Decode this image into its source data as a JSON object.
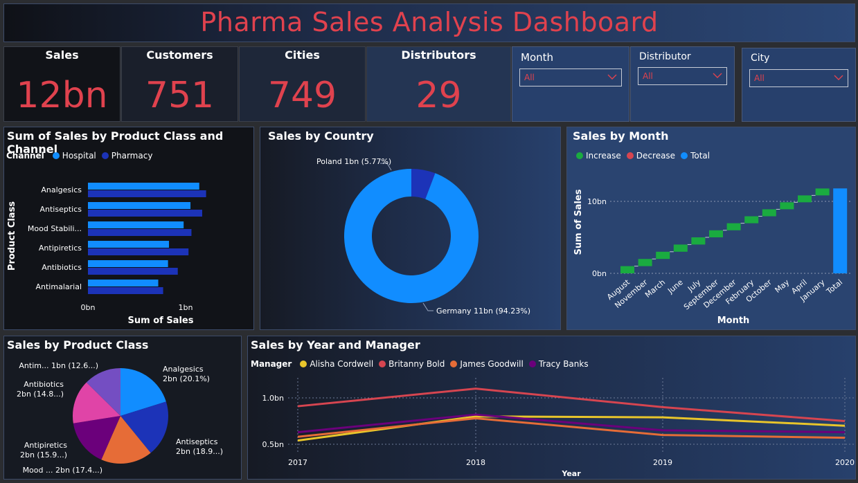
{
  "header": {
    "title": "Pharma Sales Analysis Dashboard"
  },
  "kpis": [
    {
      "label": "Sales",
      "value": "12bn"
    },
    {
      "label": "Customers",
      "value": "751"
    },
    {
      "label": "Cities",
      "value": "749"
    },
    {
      "label": "Distributors",
      "value": "29"
    }
  ],
  "slicers": {
    "month": {
      "label": "Month",
      "value": "All"
    },
    "distributor": {
      "label": "Distributor",
      "value": "All"
    },
    "city": {
      "label": "City",
      "value": "All"
    }
  },
  "colors": {
    "accent_red": "#e0424e",
    "hospital": "#118dff",
    "pharmacy": "#1c33b8",
    "increase": "#1aab40",
    "decrease": "#d64550",
    "total": "#118dff"
  },
  "chart_data": [
    {
      "type": "bar",
      "title": "Sum of Sales by Product Class and Channel",
      "legend_title": "Channel",
      "xlabel": "Sum of Sales",
      "ylabel": "Product Class",
      "categories": [
        "Analgesics",
        "Antiseptics",
        "Mood Stabili...",
        "Antipiretics",
        "Antibiotics",
        "Antimalarial"
      ],
      "series": [
        {
          "name": "Hospital",
          "values": [
            1.14,
            1.05,
            0.98,
            0.83,
            0.82,
            0.72
          ]
        },
        {
          "name": "Pharmacy",
          "values": [
            1.21,
            1.17,
            1.06,
            1.03,
            0.92,
            0.77
          ]
        }
      ],
      "xticks": [
        "0bn",
        "1bn"
      ],
      "xlim": [
        0,
        1.5
      ]
    },
    {
      "type": "pie",
      "title": "Sales by Country",
      "labels": [
        "Poland",
        "Germany"
      ],
      "values": [
        5.77,
        94.23
      ],
      "data_labels": [
        "Poland 1bn (5.77%)",
        "Germany 11bn (94.23%)"
      ]
    },
    {
      "type": "bar",
      "title": "Sales by Month",
      "legend": [
        "Increase",
        "Decrease",
        "Total"
      ],
      "xlabel": "Month",
      "ylabel": "Sum of Sales",
      "categories": [
        "August",
        "November",
        "March",
        "June",
        "July",
        "September",
        "December",
        "February",
        "October",
        "May",
        "April",
        "January",
        "Total"
      ],
      "values": [
        1.0,
        1.0,
        1.0,
        1.0,
        1.0,
        0.98,
        0.98,
        0.97,
        0.97,
        0.97,
        0.96,
        0.96,
        11.8
      ],
      "yticks": [
        "0bn",
        "10bn"
      ],
      "ylim": [
        0,
        12
      ]
    },
    {
      "type": "pie",
      "title": "Sales by Product Class",
      "labels": [
        "Analgesics",
        "Antiseptics",
        "Mood ...",
        "Antipiretics",
        "Antibiotics",
        "Antim..."
      ],
      "values": [
        20.1,
        18.9,
        17.4,
        15.9,
        14.8,
        12.6
      ],
      "data_labels": [
        [
          "Analgesics",
          "2bn (20.1%)"
        ],
        [
          "Antiseptics",
          "2bn (18.9...)"
        ],
        [
          "Mood ... 2bn (17.4...)"
        ],
        [
          "Antipiretics",
          "2bn (15.9...)"
        ],
        [
          "Antibiotics",
          "2bn (14.8...)"
        ],
        [
          "Antim... 1bn (12.6...)"
        ]
      ]
    },
    {
      "type": "line",
      "title": "Sales by Year and Manager",
      "legend_title": "Manager",
      "xlabel": "Year",
      "x": [
        "2017",
        "2018",
        "2019",
        "2020"
      ],
      "series": [
        {
          "name": "Alisha Cordwell",
          "values": [
            0.54,
            0.8,
            0.79,
            0.7
          ]
        },
        {
          "name": "Britanny Bold",
          "values": [
            0.91,
            1.1,
            0.9,
            0.75
          ]
        },
        {
          "name": "James Goodwill",
          "values": [
            0.58,
            0.78,
            0.6,
            0.57
          ]
        },
        {
          "name": "Tracy Banks",
          "values": [
            0.63,
            0.82,
            0.65,
            0.63
          ]
        }
      ],
      "yticks": [
        "0.5bn",
        "1.0bn"
      ],
      "ylim": [
        0.45,
        1.2
      ]
    }
  ]
}
